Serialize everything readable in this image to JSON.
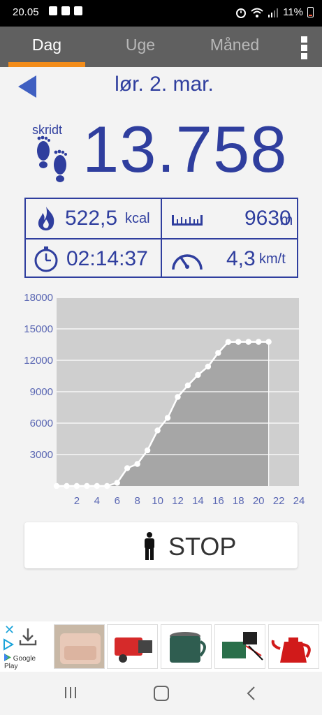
{
  "status_bar": {
    "time": "20.05",
    "battery": "11%"
  },
  "tabs": [
    {
      "label": "Dag",
      "active": true
    },
    {
      "label": "Uge",
      "active": false
    },
    {
      "label": "Måned",
      "active": false
    }
  ],
  "date_header": {
    "title": "lør. 2. mar."
  },
  "steps": {
    "label": "skridt",
    "value": "13.758"
  },
  "stats": {
    "calories": {
      "value": "522,5",
      "unit": "kcal"
    },
    "distance": {
      "value": "9630",
      "unit": "m"
    },
    "duration": {
      "value": "02:14:37"
    },
    "speed": {
      "value": "4,3",
      "unit": "km/t"
    }
  },
  "colors": {
    "accent": "#2f3e9e",
    "tab_underline": "#f28c1a",
    "tab_bg": "#606060",
    "chart_fill": "#a6a6a6",
    "chart_bg": "#cfcfcf"
  },
  "chart_data": {
    "type": "area",
    "x": [
      0,
      1,
      2,
      3,
      4,
      5,
      6,
      7,
      8,
      9,
      10,
      11,
      12,
      13,
      14,
      15,
      16,
      17,
      18,
      19,
      20,
      21
    ],
    "values": [
      0,
      0,
      0,
      0,
      0,
      0,
      300,
      1700,
      2100,
      3400,
      5300,
      6500,
      8500,
      9600,
      10600,
      11400,
      12700,
      13750,
      13758,
      13758,
      13758,
      13758
    ],
    "xticks": [
      "2",
      "4",
      "6",
      "8",
      "10",
      "12",
      "14",
      "16",
      "18",
      "20",
      "22",
      "24"
    ],
    "yticks": [
      "3000",
      "6000",
      "9000",
      "12000",
      "15000",
      "18000"
    ],
    "xlim": [
      0,
      24
    ],
    "ylim": [
      0,
      18000
    ],
    "grid": true
  },
  "stop_button": {
    "label": "STOP"
  },
  "ad": {
    "store_label": "Google Play"
  }
}
